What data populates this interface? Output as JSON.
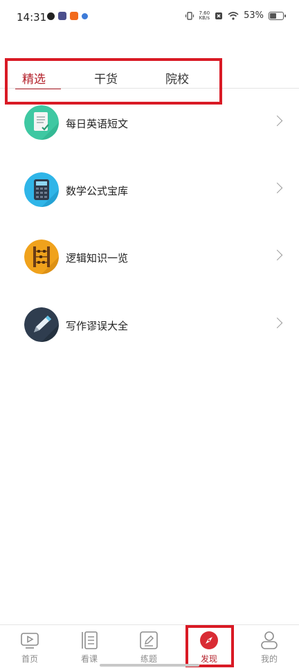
{
  "status_bar": {
    "time": "14:31",
    "net_speed_value": "7.60",
    "net_speed_unit": "KB/s",
    "battery": "53%"
  },
  "tabs": [
    {
      "label": "精选",
      "active": true
    },
    {
      "label": "干货",
      "active": false
    },
    {
      "label": "院校",
      "active": false
    }
  ],
  "list": [
    {
      "label": "每日英语短文",
      "icon": "document-icon",
      "color": "#3ec8a2"
    },
    {
      "label": "数学公式宝库",
      "icon": "calculator-icon",
      "color": "#2fb5e8"
    },
    {
      "label": "逻辑知识一览",
      "icon": "abacus-icon",
      "color": "#f0a21c"
    },
    {
      "label": "写作谬误大全",
      "icon": "pen-icon",
      "color": "#2f3d4f"
    }
  ],
  "bottom_nav": [
    {
      "label": "首页",
      "icon": "play-icon",
      "active": false
    },
    {
      "label": "看课",
      "icon": "book-icon",
      "active": false
    },
    {
      "label": "练题",
      "icon": "pencil-icon",
      "active": false
    },
    {
      "label": "发现",
      "icon": "compass-icon",
      "active": true
    },
    {
      "label": "我的",
      "icon": "user-icon",
      "active": false
    }
  ],
  "colors": {
    "accent": "#b3202a",
    "annotation_box": "#d91a25"
  }
}
